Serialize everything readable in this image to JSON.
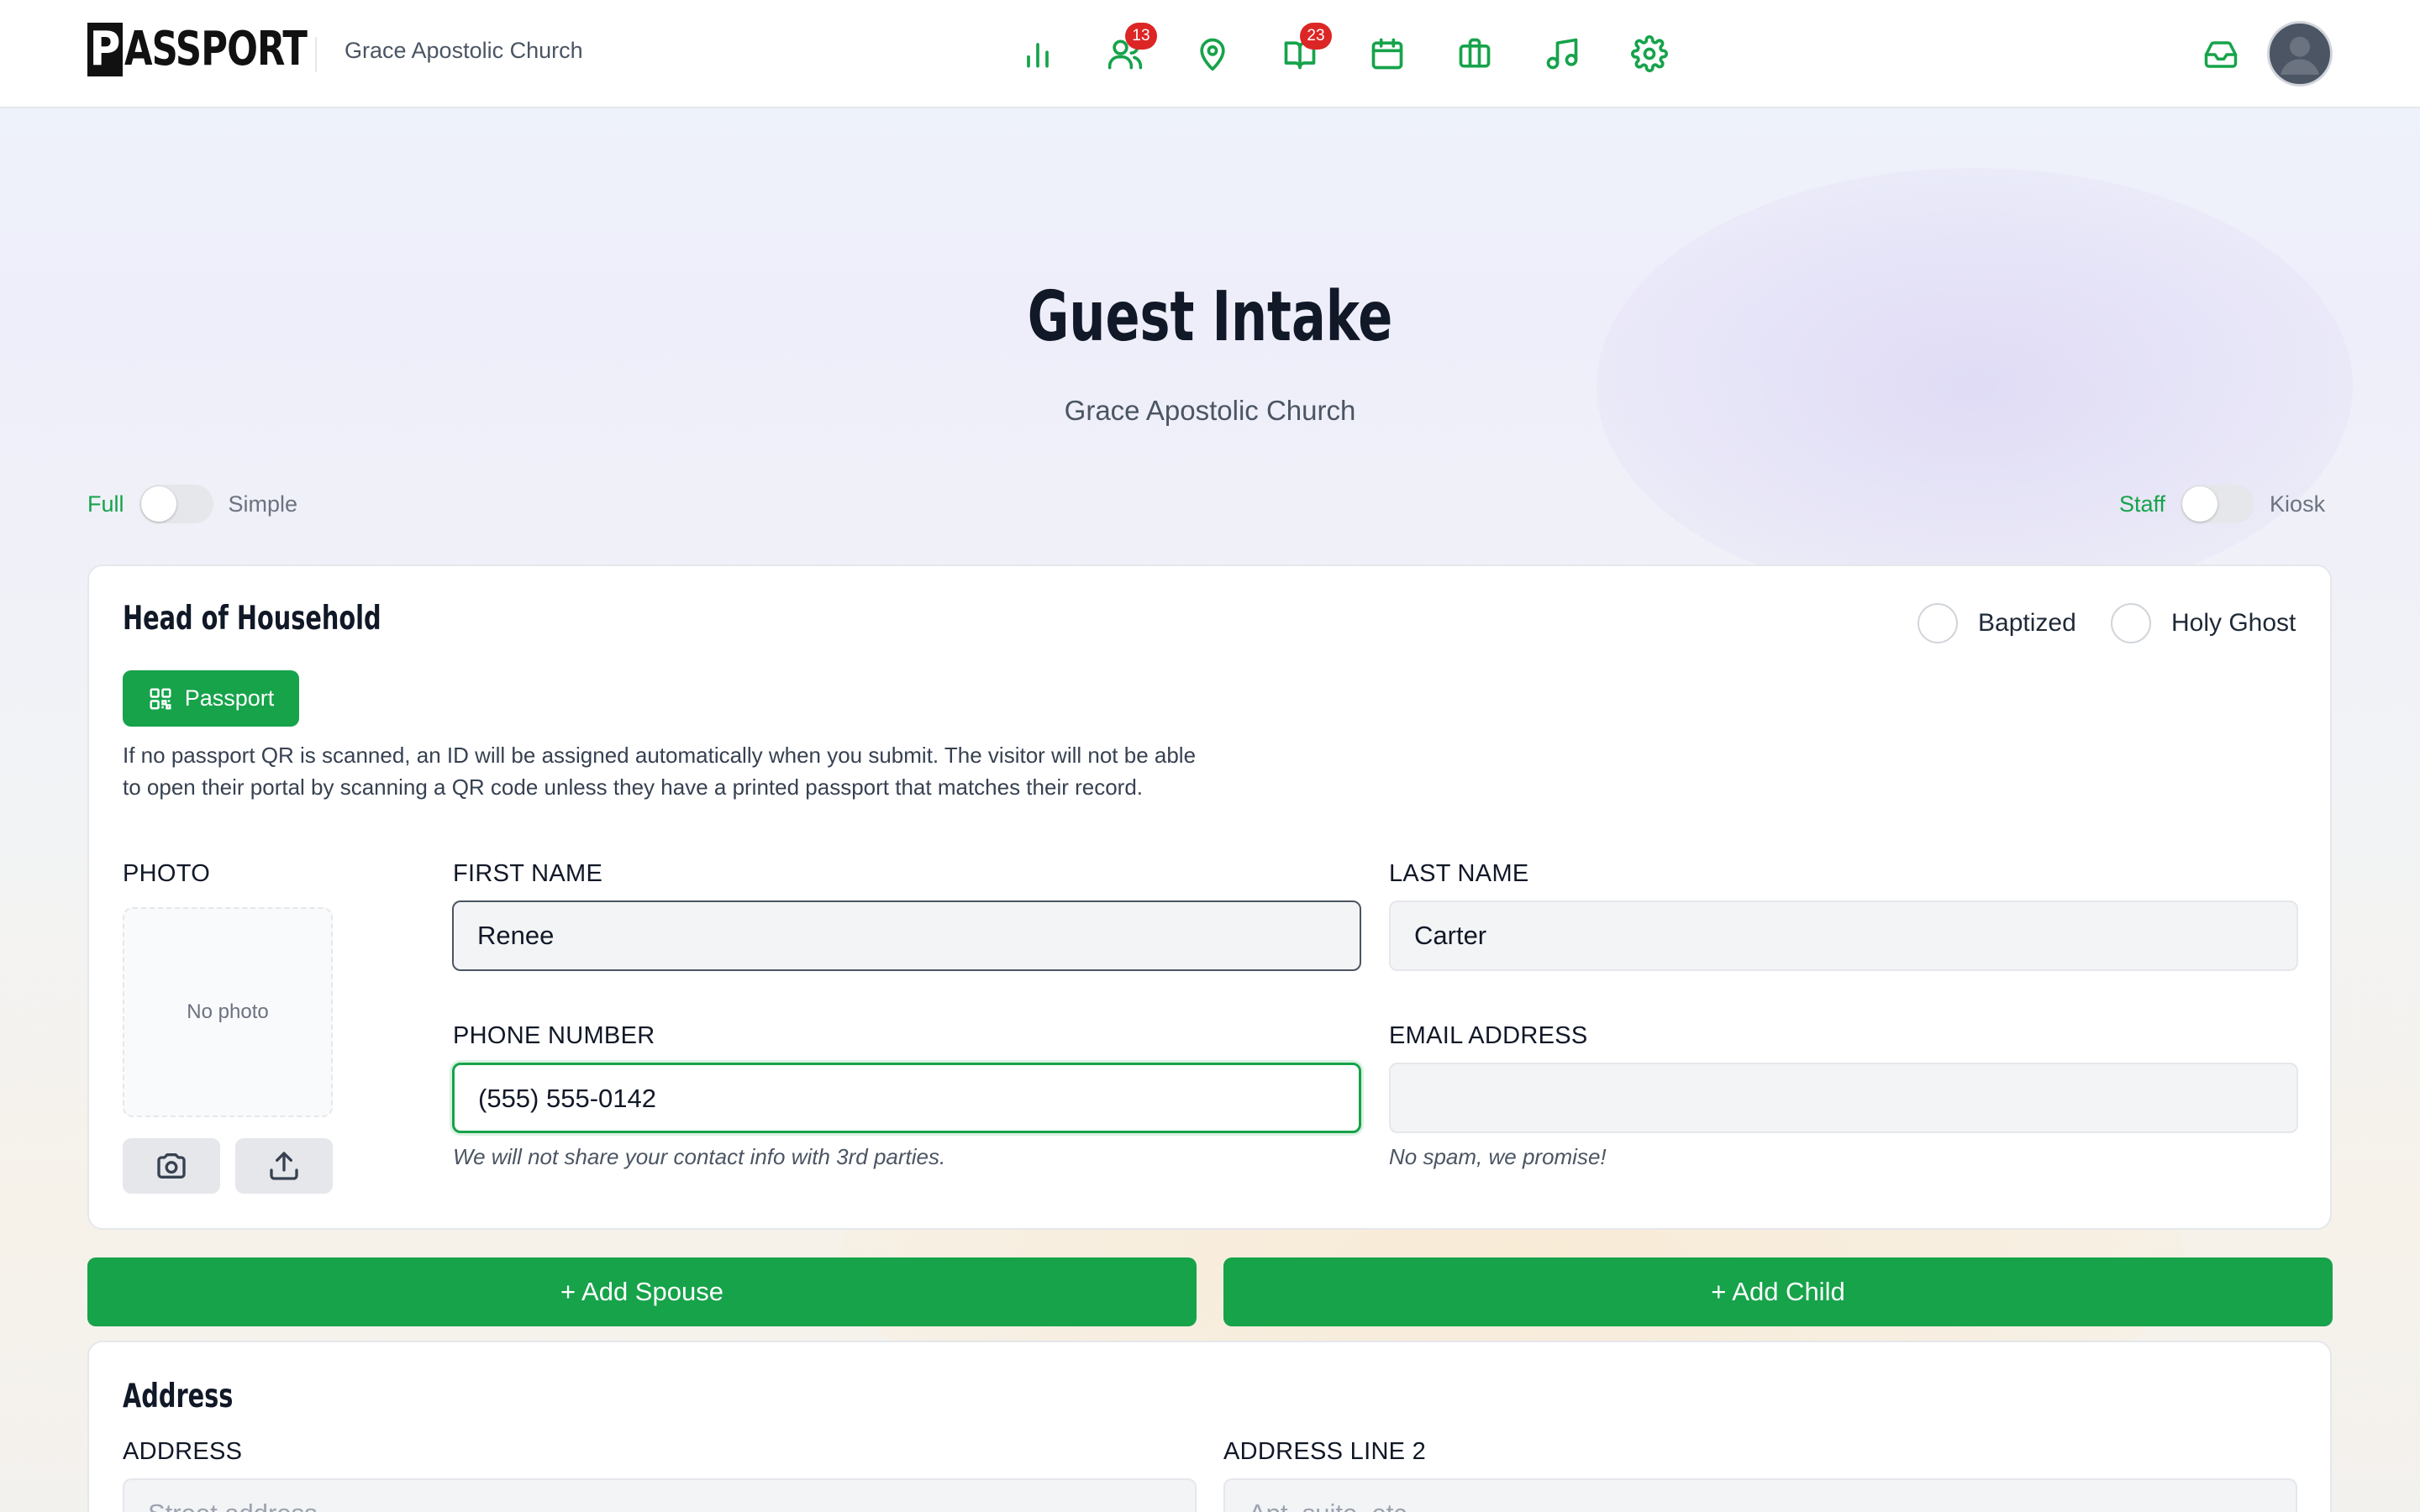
{
  "header": {
    "logo_initial": "P",
    "logo_rest": "ASSPORT",
    "org_name": "Grace Apostolic Church",
    "nav": [
      {
        "icon": "bar-chart-icon"
      },
      {
        "icon": "users-icon",
        "badge": "13"
      },
      {
        "icon": "map-pin-icon"
      },
      {
        "icon": "book-open-icon",
        "badge": "23"
      },
      {
        "icon": "calendar-icon"
      },
      {
        "icon": "briefcase-icon"
      },
      {
        "icon": "music-icon"
      },
      {
        "icon": "gear-icon"
      }
    ],
    "inbox_icon": "inbox-icon",
    "avatar_icon": "user-avatar-icon"
  },
  "hero": {
    "title": "Guest Intake",
    "subtitle": "Grace Apostolic Church"
  },
  "mode_toggle": {
    "left": "Full",
    "right": "Simple"
  },
  "role_toggle": {
    "left": "Staff",
    "right": "Kiosk"
  },
  "household": {
    "title": "Head of Household",
    "checks": [
      "Baptized",
      "Holy Ghost"
    ],
    "passport_button": "Passport",
    "note": "If no passport QR is scanned, an ID will be assigned automatically when you submit. The visitor will not be able to open their portal by scanning a QR code unless they have a printed passport that matches their record.",
    "photo_label": "PHOTO",
    "photo_placeholder": "No photo",
    "first_name_label": "FIRST NAME",
    "first_name_value": "Renee",
    "last_name_label": "LAST NAME",
    "last_name_value": "Carter",
    "phone_label": "PHONE NUMBER",
    "phone_value": "(555) 555-0142",
    "phone_hint": "We will not share your contact info with 3rd parties.",
    "email_label": "EMAIL ADDRESS",
    "email_value": "",
    "email_hint": "No spam, we promise!"
  },
  "actions": {
    "add_spouse": "+ Add Spouse",
    "add_child": "+ Add Child"
  },
  "address": {
    "title": "Address",
    "line1_label": "ADDRESS",
    "line1_placeholder": "Street address",
    "line2_label": "ADDRESS LINE 2",
    "line2_placeholder": "Apt, suite, etc."
  },
  "colors": {
    "accent": "#16a34a",
    "badge": "#dc2626"
  }
}
